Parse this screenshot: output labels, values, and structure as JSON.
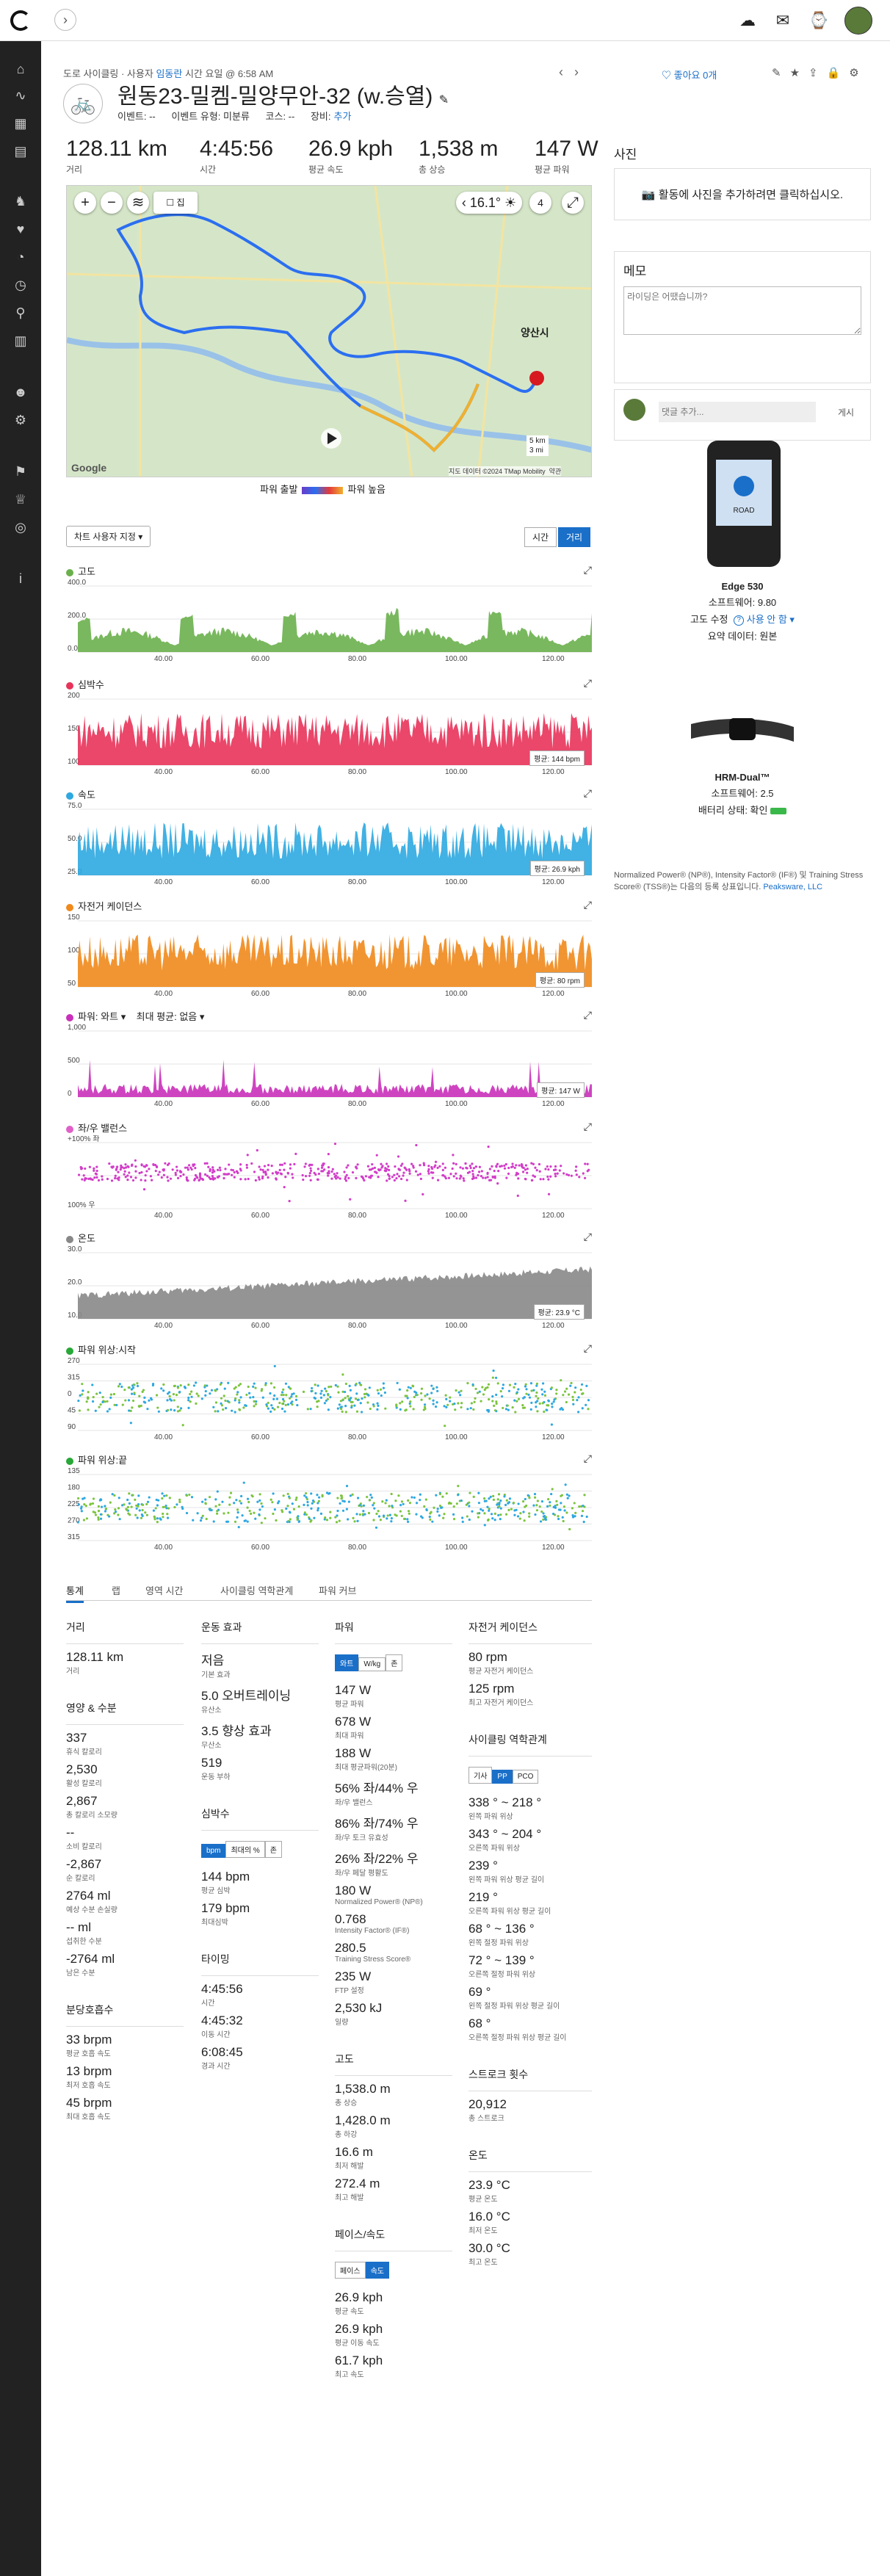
{
  "topbar": {
    "icons": [
      "expand-icon",
      "upload-icon",
      "inbox-icon",
      "watch-icon"
    ]
  },
  "sidebar": {
    "icons": [
      "home-icon",
      "wave-icon",
      "calendar-icon",
      "table-icon",
      "run-icon",
      "heart-icon",
      "gauge-icon",
      "clock-icon",
      "pin-icon",
      "bar-chart-icon",
      "group-icon",
      "bike-icon",
      "challenge-icon",
      "trophy-icon",
      "target-icon",
      "info-icon"
    ]
  },
  "header": {
    "meta_prefix": "도로 사이클링 · 사용자",
    "meta_user": "임동란",
    "meta_suffix": "시간 요일 @ 6:58 AM",
    "title": "원동23-밀켐-밀양무안-32 (w.승열)",
    "event": "이벤트: --",
    "event_type": "이벤트 유형: 미분류",
    "course": "코스: --",
    "gear_label": "장비:",
    "gear_add": "추가",
    "like": "좋아요 0개"
  },
  "stats": [
    {
      "value": "128.11 km",
      "label": "거리"
    },
    {
      "value": "4:45:56",
      "label": "시간"
    },
    {
      "value": "26.9 kph",
      "label": "평균 속도"
    },
    {
      "value": "1,538 m",
      "label": "총 상승"
    },
    {
      "value": "147 W",
      "label": "평균 파워"
    }
  ],
  "map": {
    "temp": "16.1°",
    "count": "4",
    "city": "양산시",
    "scale1": "5 km",
    "scale2": "3 mi",
    "google": "Google",
    "attribution": "지도 데이터 ©2024 TMap Mobility",
    "terms": "약관",
    "checkbox_label": "집"
  },
  "legend": {
    "left": "파워 출발",
    "right": "파워 높음"
  },
  "chart_controls": {
    "select": "차트 사용자 지정",
    "toggle_time": "시간",
    "toggle_dist": "거리"
  },
  "charts": [
    {
      "title": "고도",
      "color": "#6ab04c",
      "ylabels": [
        "400.0",
        "200.0",
        "0.0"
      ],
      "avg": ""
    },
    {
      "title": "심박수",
      "color": "#e8335a",
      "ylabels": [
        "200",
        "150",
        "100"
      ],
      "avg": "평균: 144 bpm"
    },
    {
      "title": "속도",
      "color": "#2ea8e0",
      "ylabels": [
        "75.0",
        "50.0",
        "25.0"
      ],
      "avg": "평균: 26.9 kph"
    },
    {
      "title": "자전거 케이던스",
      "color": "#f08a1c",
      "ylabels": [
        "150",
        "100",
        "50"
      ],
      "avg": "평균: 80 rpm"
    },
    {
      "title": "파워: 와트",
      "color": "#c930b9",
      "ylabels": [
        "1,000",
        "500",
        "0"
      ],
      "avg": "평균: 147 W",
      "extra": "최대 평균: 없음"
    },
    {
      "title": "좌/우 밸런스",
      "color": "#e060c8",
      "ylabels": [
        "+100% 좌",
        "",
        "100% 우"
      ],
      "avg": ""
    },
    {
      "title": "온도",
      "color": "#888888",
      "ylabels": [
        "30.0",
        "20.0",
        "10.0"
      ],
      "avg": "평균: 23.9 °C"
    },
    {
      "title": "파워 위상:시작",
      "color": "#27a837",
      "ylabels": [
        "270",
        "315",
        "0",
        "45",
        "90"
      ],
      "avg": ""
    },
    {
      "title": "파워 위상:끝",
      "color": "#27a837",
      "ylabels": [
        "135",
        "180",
        "225",
        "270",
        "315"
      ],
      "avg": ""
    }
  ],
  "xlabels": [
    "40.00",
    "60.00",
    "80.00",
    "100.00",
    "120.00"
  ],
  "tabs": [
    "통계",
    "랩",
    "영역 시간",
    "사이클링 역학관계",
    "파워 커브"
  ],
  "col1": {
    "heading": "거리",
    "items": [
      {
        "v": "128.11 km",
        "l": "거리"
      }
    ],
    "nut_heading": "영양 & 수분",
    "nut": [
      {
        "v": "337",
        "l": "휴식 칼로리"
      },
      {
        "v": "2,530",
        "l": "활성 칼로리"
      },
      {
        "v": "2,867",
        "l": "총 칼로리 소모량"
      },
      {
        "v": "--",
        "l": "소비 칼로리"
      },
      {
        "v": "-2,867",
        "l": "순 칼로리"
      },
      {
        "v": "2764 ml",
        "l": "예상 수분 손실량"
      },
      {
        "v": "-- ml",
        "l": "섭취한 수분"
      },
      {
        "v": "-2764 ml",
        "l": "남은 수분"
      }
    ],
    "resp_heading": "분당호흡수",
    "resp": [
      {
        "v": "33 brpm",
        "l": "평균 호흡 속도"
      },
      {
        "v": "13 brpm",
        "l": "최저 호흡 속도"
      },
      {
        "v": "45 brpm",
        "l": "최대 호흡 속도"
      }
    ]
  },
  "col2": {
    "heading": "운동 효과",
    "effect": [
      {
        "v": "저음",
        "l": "기본 효과"
      },
      {
        "v": "5.0 오버트레이닝",
        "l": "유산소"
      },
      {
        "v": "3.5 향상 효과",
        "l": "무산소"
      },
      {
        "v": "519",
        "l": "운동 부하"
      }
    ],
    "hr_heading": "심박수",
    "hr_pills": [
      "bpm",
      "최대의 %",
      "존"
    ],
    "hr": [
      {
        "v": "144 bpm",
        "l": "평균 심박"
      },
      {
        "v": "179 bpm",
        "l": "최대심박"
      }
    ],
    "time_heading": "타이밍",
    "time": [
      {
        "v": "4:45:56",
        "l": "시간"
      },
      {
        "v": "4:45:32",
        "l": "이동 시간"
      },
      {
        "v": "6:08:45",
        "l": "경과 시간"
      }
    ]
  },
  "col3": {
    "heading": "파워",
    "pills": [
      "와트",
      "W/kg",
      "존"
    ],
    "items": [
      {
        "v": "147 W",
        "l": "평균 파워"
      },
      {
        "v": "678 W",
        "l": "최대 파워"
      },
      {
        "v": "188 W",
        "l": "최대 평균파워(20분)"
      },
      {
        "v": "56% 좌/44% 우",
        "l": "좌/우 밸런스"
      },
      {
        "v": "86% 좌/74% 우",
        "l": "좌/우 토크 유효성"
      },
      {
        "v": "26% 좌/22% 우",
        "l": "좌/우 페달 평활도"
      },
      {
        "v": "180 W",
        "l": "Normalized Power® (NP®)"
      },
      {
        "v": "0.768",
        "l": "Intensity Factor® (IF®)"
      },
      {
        "v": "280.5",
        "l": "Training Stress Score®"
      },
      {
        "v": "235 W",
        "l": "FTP 설정"
      },
      {
        "v": "2,530 kJ",
        "l": "일량"
      }
    ],
    "elev_heading": "고도",
    "elev": [
      {
        "v": "1,538.0 m",
        "l": "총 상승"
      },
      {
        "v": "1,428.0 m",
        "l": "총 하강"
      },
      {
        "v": "16.6 m",
        "l": "최저 해발"
      },
      {
        "v": "272.4 m",
        "l": "최고 해발"
      }
    ],
    "pace_heading": "페이스/속도",
    "pace_pills": [
      "페이스",
      "속도"
    ],
    "pace": [
      {
        "v": "26.9 kph",
        "l": "평균 속도"
      },
      {
        "v": "26.9 kph",
        "l": "평균 이동 속도"
      },
      {
        "v": "61.7 kph",
        "l": "최고 속도"
      }
    ]
  },
  "col4": {
    "heading": "자전거 케이던스",
    "cad": [
      {
        "v": "80 rpm",
        "l": "평균 자전거 케이던스"
      },
      {
        "v": "125 rpm",
        "l": "최고 자전거 케이던스"
      }
    ],
    "dyn_heading": "사이클링 역학관계",
    "dyn_pills": [
      "기사",
      "PP",
      "PCO"
    ],
    "dyn": [
      {
        "v": "338 ° ~ 218 °",
        "l": "왼쪽 파워 위상"
      },
      {
        "v": "343 ° ~ 204 °",
        "l": "오른쪽 파워 위상"
      },
      {
        "v": "239 °",
        "l": "왼쪽 파워 위상 평균 길이"
      },
      {
        "v": "219 °",
        "l": "오른쪽 파워 위상 평균 길이"
      },
      {
        "v": "68 ° ~ 136 °",
        "l": "왼쪽 절정 파워 위상"
      },
      {
        "v": "72 ° ~ 139 °",
        "l": "오른쪽 절정 파워 위상"
      },
      {
        "v": "69 °",
        "l": "왼쪽 절정 파워 위상 평균 길이"
      },
      {
        "v": "68 °",
        "l": "오른쪽 절정 파워 위상 평균 길이"
      }
    ],
    "stroke_heading": "스트로크 횟수",
    "stroke": [
      {
        "v": "20,912",
        "l": "총 스트로크"
      }
    ],
    "temp_heading": "온도",
    "temp": [
      {
        "v": "23.9 °C",
        "l": "평균 온도"
      },
      {
        "v": "16.0 °C",
        "l": "최저 온도"
      },
      {
        "v": "30.0 °C",
        "l": "최고 온도"
      }
    ]
  },
  "right": {
    "photo_title": "사진",
    "photo_text": "활동에 사진을 추가하려면 클릭하십시오.",
    "memo_title": "메모",
    "memo_placeholder": "라이딩은 어땠습니까?",
    "comment_placeholder": "댓글 추가...",
    "comment_btn": "게시",
    "device1": {
      "name": "Edge 530",
      "sw": "소프트웨어: 9.80",
      "elev": "고도 수정",
      "elev_val": "사용 안 함",
      "summary": "요약 데이터: 원본",
      "screen": "ROAD"
    },
    "device2": {
      "name": "HRM-Dual™",
      "sw": "소프트웨어: 2.5",
      "battery": "배터리 상태: 확인"
    },
    "footnote": "Normalized Power® (NP®), Intensity Factor® (IF®) 및 Training Stress Score® (TSS®)는 다음의 등록 상표입니다.",
    "footnote_link": "Peaksware, LLC"
  }
}
